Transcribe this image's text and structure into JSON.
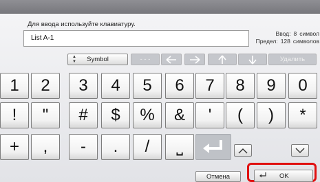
{
  "prompt": "Для ввода используйте клавиатуру.",
  "input": {
    "value": "List A-1"
  },
  "counter": {
    "entered_label": "Ввод:",
    "entered_value": "8",
    "entered_unit": "символ",
    "limit_label": "Предел:",
    "limit_value": "128",
    "limit_unit": "символов"
  },
  "function_keys": {
    "symbol_label": "Symbol",
    "blank_label": "- - -",
    "delete_label": "Удалить"
  },
  "rows": [
    [
      "1",
      "2",
      "3",
      "4",
      "5",
      "6",
      "7",
      "8",
      "9",
      "0"
    ],
    [
      "!",
      "\"",
      "#",
      "$",
      "%",
      "&",
      "'",
      "(",
      ")",
      "*"
    ],
    [
      "+",
      ",",
      "-",
      ".",
      "/",
      "⎵"
    ]
  ],
  "bottom": {
    "cancel_label": "Отмена",
    "ok_label": "OK"
  }
}
